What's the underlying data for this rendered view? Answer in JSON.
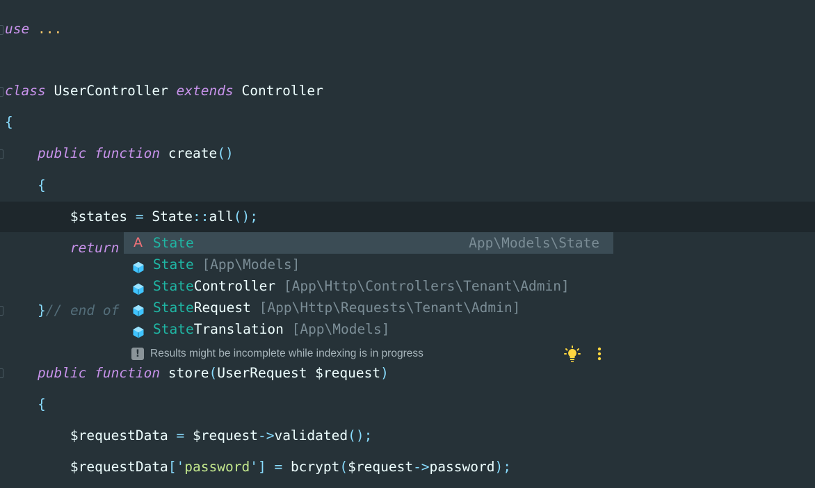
{
  "editor": {
    "lines": [
      {
        "id": "l1",
        "tokens": [
          [
            "kw",
            "use"
          ],
          [
            "id",
            " "
          ],
          [
            "dots",
            "..."
          ]
        ]
      },
      {
        "id": "l2",
        "tokens": [
          [
            "kw",
            "class"
          ],
          [
            "id",
            " UserController "
          ],
          [
            "kw",
            "extends"
          ],
          [
            "id",
            " Controller"
          ]
        ]
      },
      {
        "id": "l3",
        "tokens": [
          [
            "punc",
            "{"
          ]
        ]
      },
      {
        "id": "l4",
        "tokens": [
          [
            "id",
            "    "
          ],
          [
            "kw",
            "public"
          ],
          [
            "id",
            " "
          ],
          [
            "kw",
            "function"
          ],
          [
            "id",
            " create"
          ],
          [
            "punc",
            "()"
          ]
        ]
      },
      {
        "id": "l5",
        "tokens": [
          [
            "id",
            "    "
          ],
          [
            "punc",
            "{"
          ]
        ]
      },
      {
        "id": "l6",
        "tokens": [
          [
            "id",
            "        $states "
          ],
          [
            "punc",
            "="
          ],
          [
            "id",
            " State"
          ],
          [
            "punc",
            "::"
          ],
          [
            "id",
            "all"
          ],
          [
            "punc",
            "();"
          ]
        ]
      },
      {
        "id": "l7",
        "tokens": [
          [
            "id",
            "        "
          ],
          [
            "kw",
            "return"
          ]
        ]
      },
      {
        "id": "l8",
        "tokens": [
          [
            "id",
            "    "
          ],
          [
            "punc",
            "}"
          ],
          [
            "cmt",
            "// end of"
          ]
        ]
      },
      {
        "id": "l9",
        "tokens": [
          [
            "id",
            "    "
          ],
          [
            "kw",
            "public"
          ],
          [
            "id",
            " "
          ],
          [
            "kw",
            "function"
          ],
          [
            "id",
            " store"
          ],
          [
            "punc",
            "("
          ],
          [
            "id",
            "UserRequest $request"
          ],
          [
            "punc",
            ")"
          ]
        ]
      },
      {
        "id": "l10",
        "tokens": [
          [
            "id",
            "    "
          ],
          [
            "punc",
            "{"
          ]
        ]
      },
      {
        "id": "l11",
        "tokens": [
          [
            "id",
            "        $requestData "
          ],
          [
            "punc",
            "="
          ],
          [
            "id",
            " $request"
          ],
          [
            "punc",
            "->"
          ],
          [
            "id",
            "validated"
          ],
          [
            "punc",
            "();"
          ]
        ]
      },
      {
        "id": "l12",
        "tokens": [
          [
            "id",
            "        $requestData"
          ],
          [
            "punc",
            "['"
          ],
          [
            "str",
            "password"
          ],
          [
            "punc",
            "']"
          ],
          [
            "id",
            " "
          ],
          [
            "punc",
            "="
          ],
          [
            "id",
            " bcrypt"
          ],
          [
            "punc",
            "("
          ],
          [
            "id",
            "$request"
          ],
          [
            "punc",
            "->"
          ],
          [
            "id",
            "password"
          ],
          [
            "punc",
            ");"
          ]
        ]
      }
    ]
  },
  "autocomplete": {
    "items": [
      {
        "icon": "abc-icon",
        "match": "State",
        "rest": "",
        "pkg": "",
        "tail": "App\\Models\\State",
        "selected": true
      },
      {
        "icon": "class-icon",
        "match": "State",
        "rest": "",
        "pkg": " [App\\Models]",
        "tail": "",
        "selected": false
      },
      {
        "icon": "class-icon",
        "match": "State",
        "rest": "Controller",
        "pkg": " [App\\Http\\Controllers\\Tenant\\Admin]",
        "tail": "",
        "selected": false
      },
      {
        "icon": "class-icon",
        "match": "State",
        "rest": "Request",
        "pkg": " [App\\Http\\Requests\\Tenant\\Admin]",
        "tail": "",
        "selected": false
      },
      {
        "icon": "class-icon",
        "match": "State",
        "rest": "Translation",
        "pkg": " [App\\Models]",
        "tail": "",
        "selected": false
      }
    ],
    "footer": {
      "warning_glyph": "!",
      "message": "Results might be incomplete while indexing is in progress"
    }
  },
  "colors": {
    "background": "#263238",
    "keyword": "#c792ea",
    "match": "#1fb6a4",
    "string": "#c3e88d",
    "comment": "#546e7a",
    "class_icon": "#40c4ff",
    "bulb": "#ffd740"
  }
}
